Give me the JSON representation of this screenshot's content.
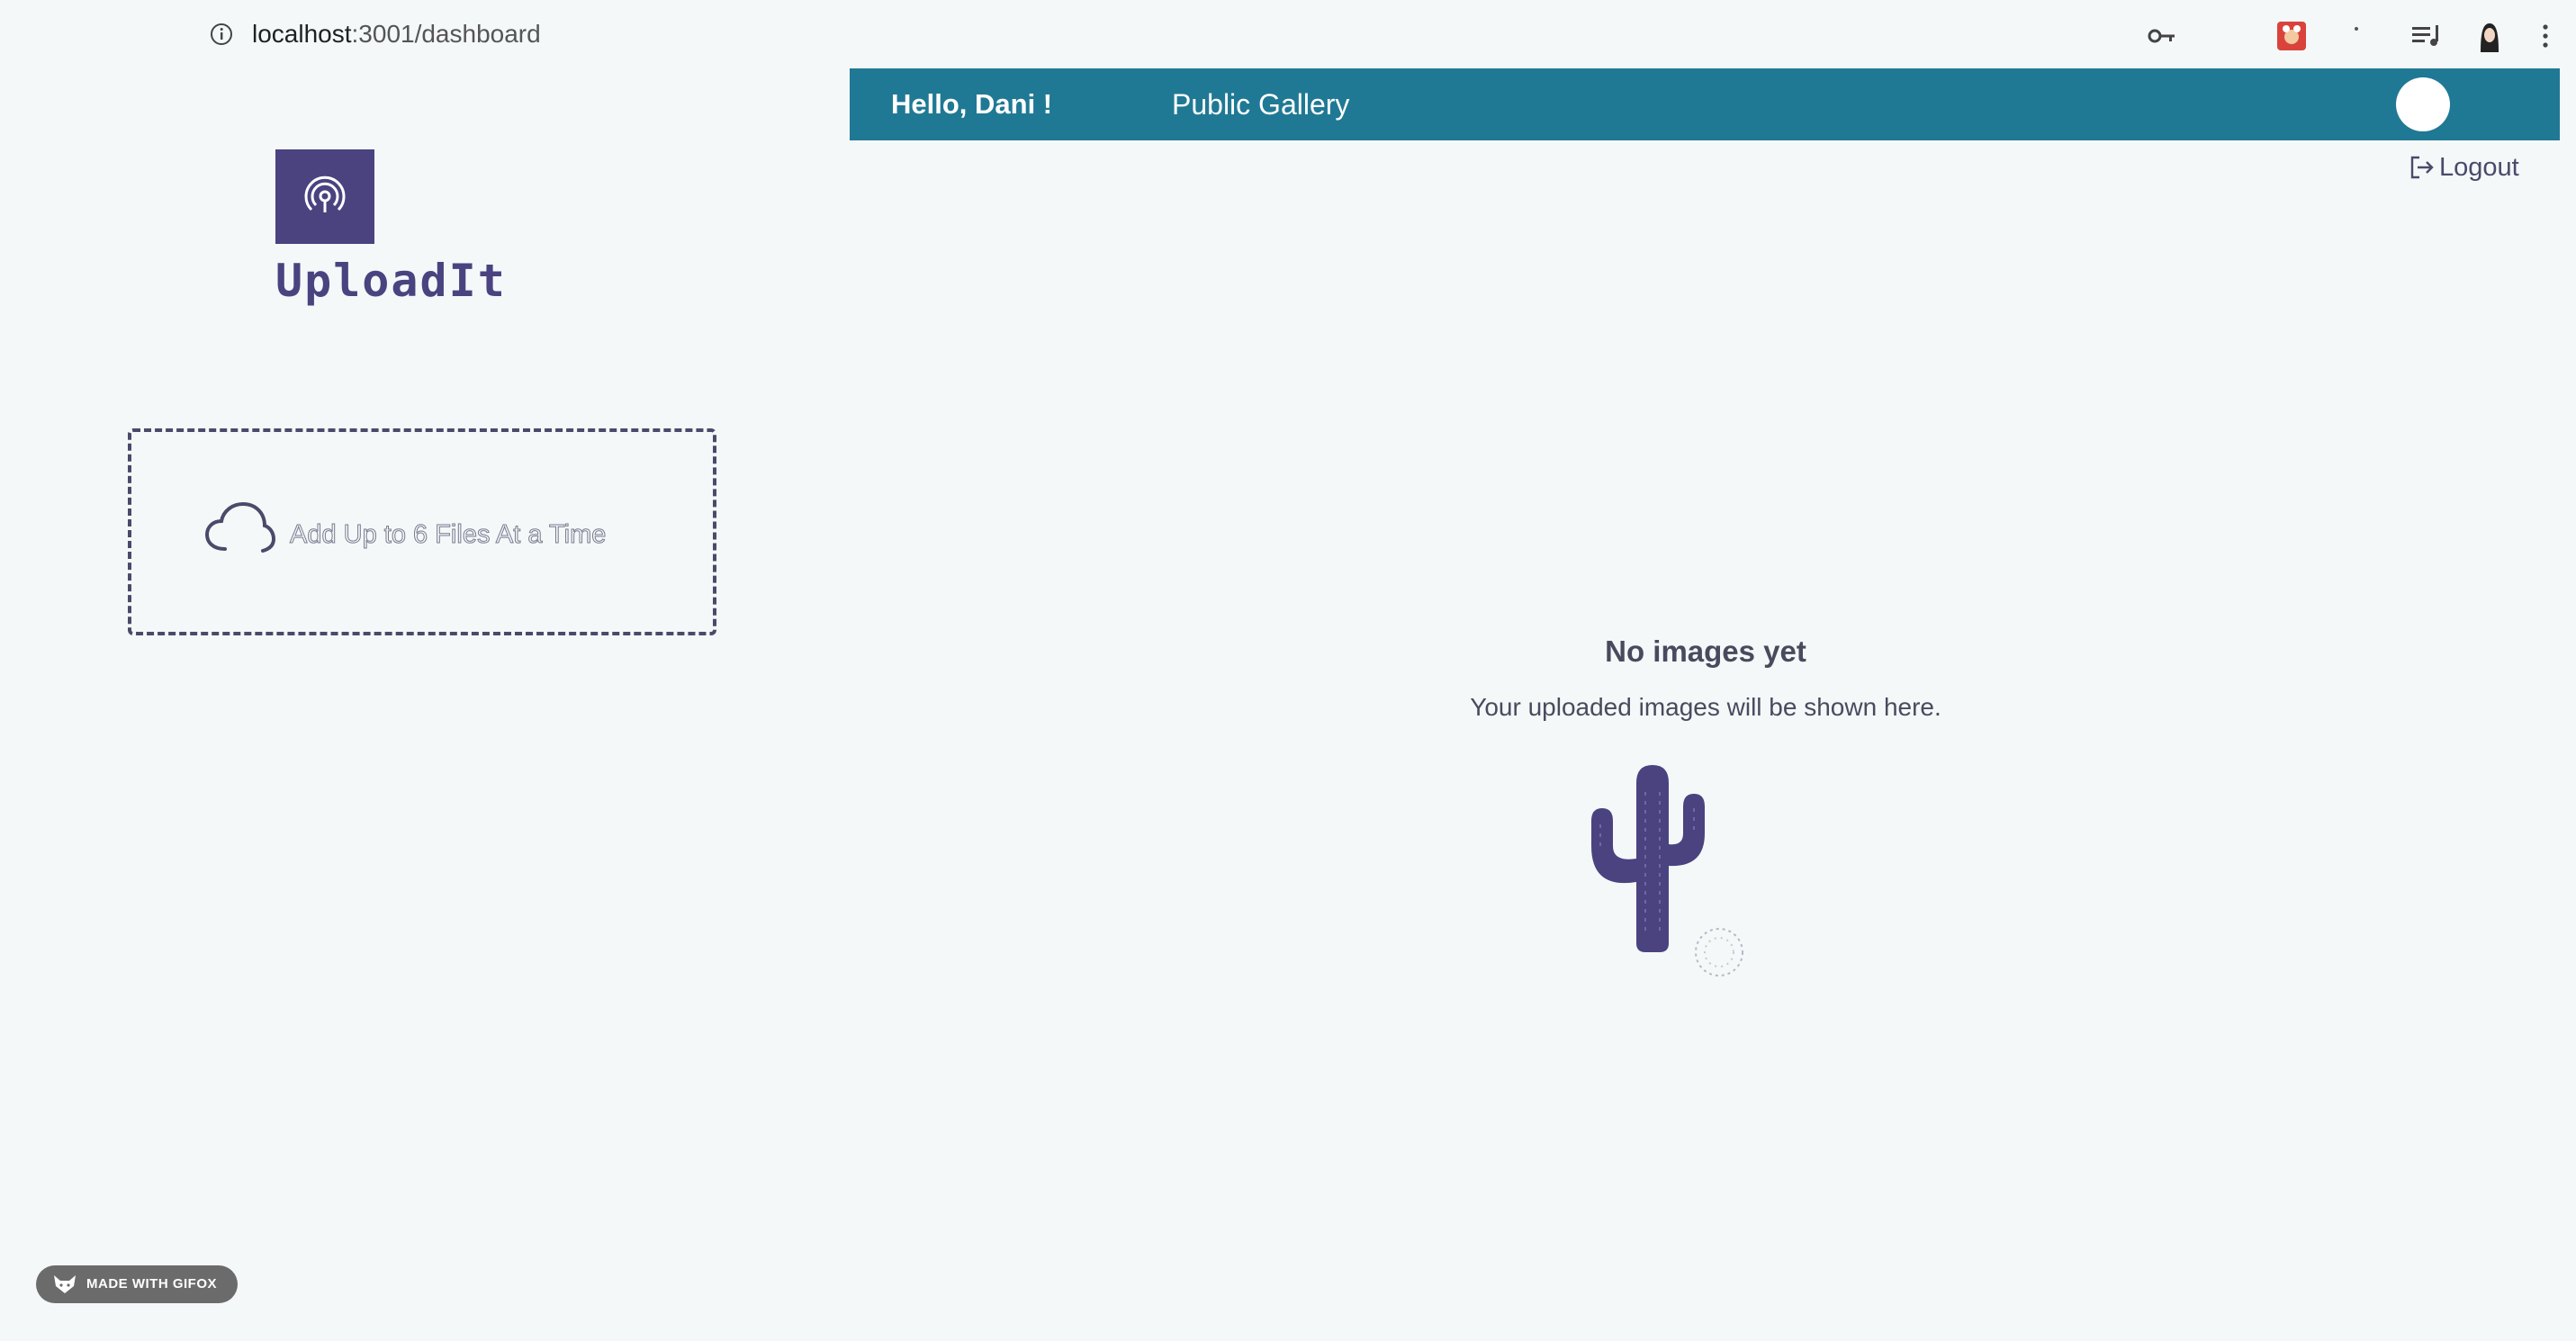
{
  "browser": {
    "url_host": "localhost",
    "url_path": ":3001/dashboard"
  },
  "header": {
    "greeting": "Hello, Dani !",
    "nav_gallery": "Public Gallery",
    "logout_label": "Logout",
    "bar_color": "#207994"
  },
  "logo": {
    "title": "UploadIt",
    "color": "#4a4380"
  },
  "upload": {
    "dropzone_text": "Add Up to 6 Files At a Time"
  },
  "empty_state": {
    "title": "No images yet",
    "subtitle": "Your uploaded images will be shown here."
  },
  "watermark": {
    "label": "MADE WITH GIFOX"
  }
}
